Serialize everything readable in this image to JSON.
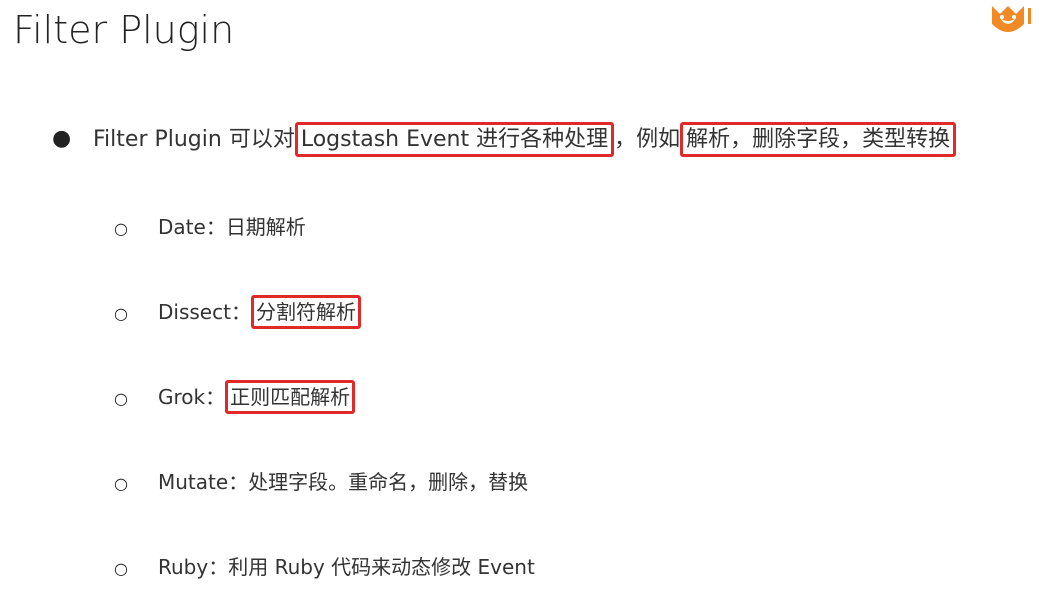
{
  "slide": {
    "title": "Filter Plugin",
    "logo_icon": "fox-logo-icon"
  },
  "main_bullet": {
    "marker": "●",
    "prefix": "Filter Plugin 可以对",
    "highlight_1": "Logstash Event 进行各种处理",
    "middle": "，例如",
    "highlight_2": "解析，删除字段，类型转换"
  },
  "sub_bullets": {
    "marker": "○",
    "items": [
      {
        "label": "Date",
        "sep": "：",
        "text": "日期解析"
      },
      {
        "label": "Dissect",
        "sep": "：",
        "highlight": "分割符解析"
      },
      {
        "label": "Grok",
        "sep": "：",
        "highlight": "正则匹配解析"
      },
      {
        "label": "Mutate",
        "sep": "：",
        "text": "处理字段。重命名，删除，替换"
      },
      {
        "label": "Ruby",
        "sep": "：",
        "text": "利用 Ruby 代码来动态修改 Event"
      }
    ]
  },
  "colors": {
    "highlight_border": "#e02a2a",
    "logo_orange": "#f08a24"
  }
}
